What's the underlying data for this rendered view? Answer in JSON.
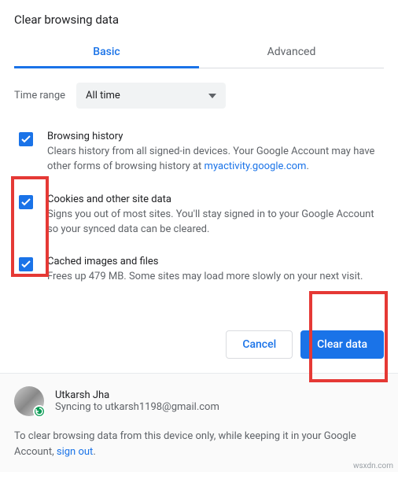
{
  "title": "Clear browsing data",
  "tabs": {
    "basic": "Basic",
    "advanced": "Advanced"
  },
  "time": {
    "label": "Time range",
    "value": "All time"
  },
  "options": [
    {
      "title": "Browsing history",
      "desc_a": "Clears history from all signed-in devices. Your Google Account may have other forms of browsing history at ",
      "link": "myactivity.google.com",
      "desc_b": "."
    },
    {
      "title": "Cookies and other site data",
      "desc_a": "Signs you out of most sites. You'll stay signed in to your Google Account so your synced data can be cleared.",
      "link": "",
      "desc_b": ""
    },
    {
      "title": "Cached images and files",
      "desc_a": "Frees up 479 MB. Some sites may load more slowly on your next visit.",
      "link": "",
      "desc_b": ""
    }
  ],
  "actions": {
    "cancel": "Cancel",
    "clear": "Clear data"
  },
  "profile": {
    "name": "Utkarsh Jha",
    "sync": "Syncing to utkarsh1198@gmail.com"
  },
  "footer": {
    "note_a": "To clear browsing data from this device only, while keeping it in your Google Account, ",
    "link": "sign out",
    "note_b": "."
  },
  "watermark": "wsxdn.com"
}
